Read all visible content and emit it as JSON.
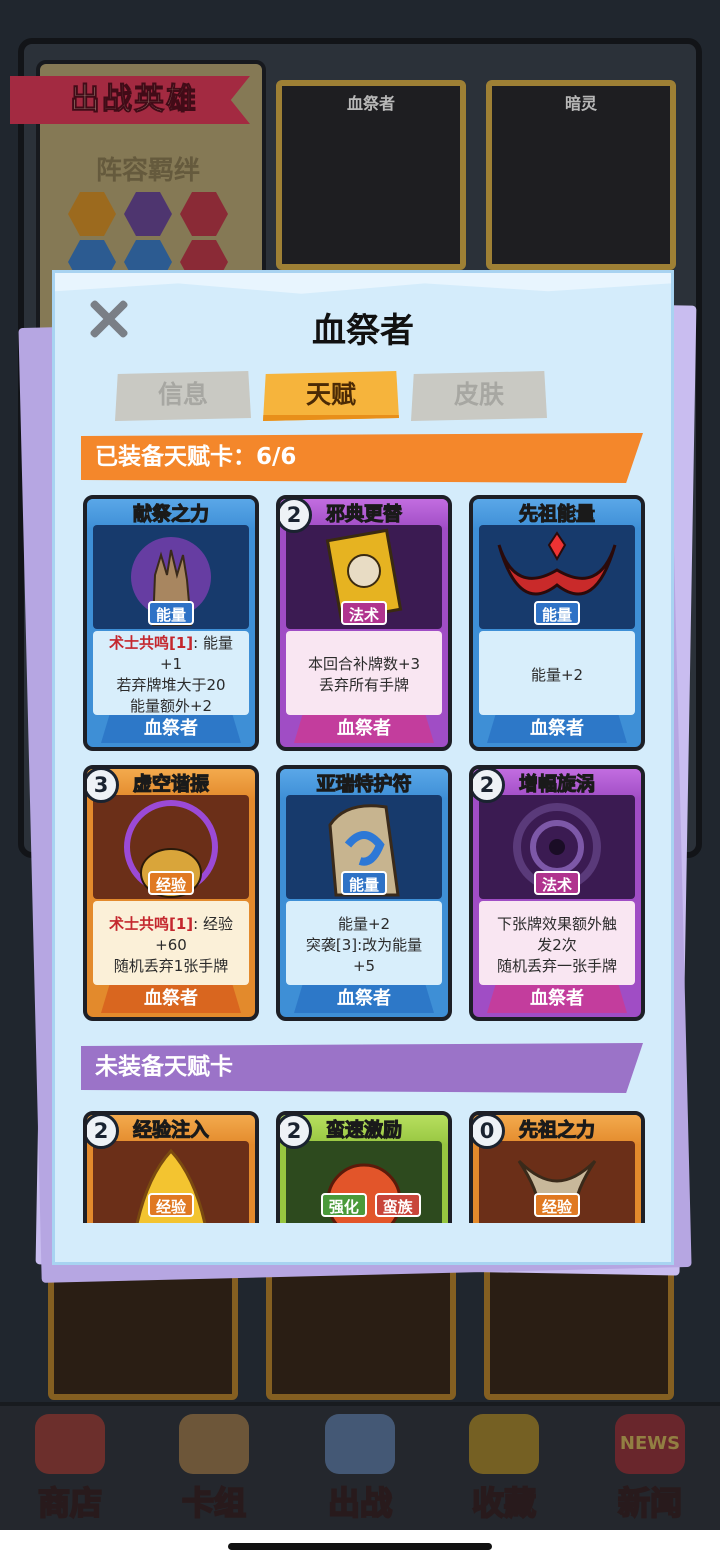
{
  "background": {
    "banner_title": "出战英雄",
    "bond_title": "阵容羁绊",
    "hero_cards": [
      {
        "name": "血祭者"
      },
      {
        "name": "暗灵"
      }
    ]
  },
  "nav": {
    "items": [
      {
        "label": "商店",
        "icon": "shop-icon"
      },
      {
        "label": "卡组",
        "icon": "deck-icon"
      },
      {
        "label": "出战",
        "icon": "battle-icon"
      },
      {
        "label": "收藏",
        "icon": "collection-icon"
      },
      {
        "label": "新闻",
        "icon": "news-icon"
      }
    ],
    "news_badge": "NEWS"
  },
  "dialog": {
    "title": "血祭者",
    "close_icon": "close-icon",
    "tabs": [
      {
        "label": "信息",
        "active": false
      },
      {
        "label": "天赋",
        "active": true
      },
      {
        "label": "皮肤",
        "active": false
      }
    ],
    "equipped_header": "已装备天赋卡：6/6",
    "unequipped_header": "未装备天赋卡",
    "equipped_cards": [
      {
        "name": "献祭之力",
        "cost": "",
        "type": "能量",
        "theme": "blue",
        "highlight": "术士共鸣[1]",
        "lines": [
          ": 能量",
          "+1",
          "若弃牌堆大于20",
          "能量额外+2"
        ],
        "owner": "血祭者"
      },
      {
        "name": "邪典更替",
        "cost": "2",
        "type": "法术",
        "theme": "purple",
        "highlight": "",
        "lines": [
          "本回合补牌数+3",
          "丢弃所有手牌"
        ],
        "owner": "血祭者"
      },
      {
        "name": "先祖能量",
        "cost": "",
        "type": "能量",
        "theme": "blue",
        "highlight": "",
        "lines": [
          "能量+2"
        ],
        "owner": "血祭者"
      },
      {
        "name": "虚空谐振",
        "cost": "3",
        "type": "经验",
        "theme": "orange",
        "highlight": "术士共鸣[1]",
        "lines": [
          ": 经验",
          "+60",
          "随机丢弃1张手牌"
        ],
        "owner": "血祭者"
      },
      {
        "name": "亚瑞特护符",
        "cost": "",
        "type": "能量",
        "theme": "blue",
        "highlight": "",
        "lines": [
          "能量+2",
          "突袭[3]:改为能量",
          "+5"
        ],
        "owner": "血祭者"
      },
      {
        "name": "增幅旋涡",
        "cost": "2",
        "type": "法术",
        "theme": "purple",
        "highlight": "",
        "lines": [
          "下张牌效果额外触",
          "发2次",
          "随机丢弃一张手牌"
        ],
        "owner": "血祭者"
      }
    ],
    "unequipped_cards": [
      {
        "name": "经验注入",
        "cost": "2",
        "types": [
          "经验"
        ],
        "theme": "orange"
      },
      {
        "name": "蛮速激励",
        "cost": "2",
        "types": [
          "强化",
          "蛮族"
        ],
        "theme": "green"
      },
      {
        "name": "先祖之力",
        "cost": "0",
        "types": [
          "经验"
        ],
        "theme": "orange"
      }
    ]
  }
}
